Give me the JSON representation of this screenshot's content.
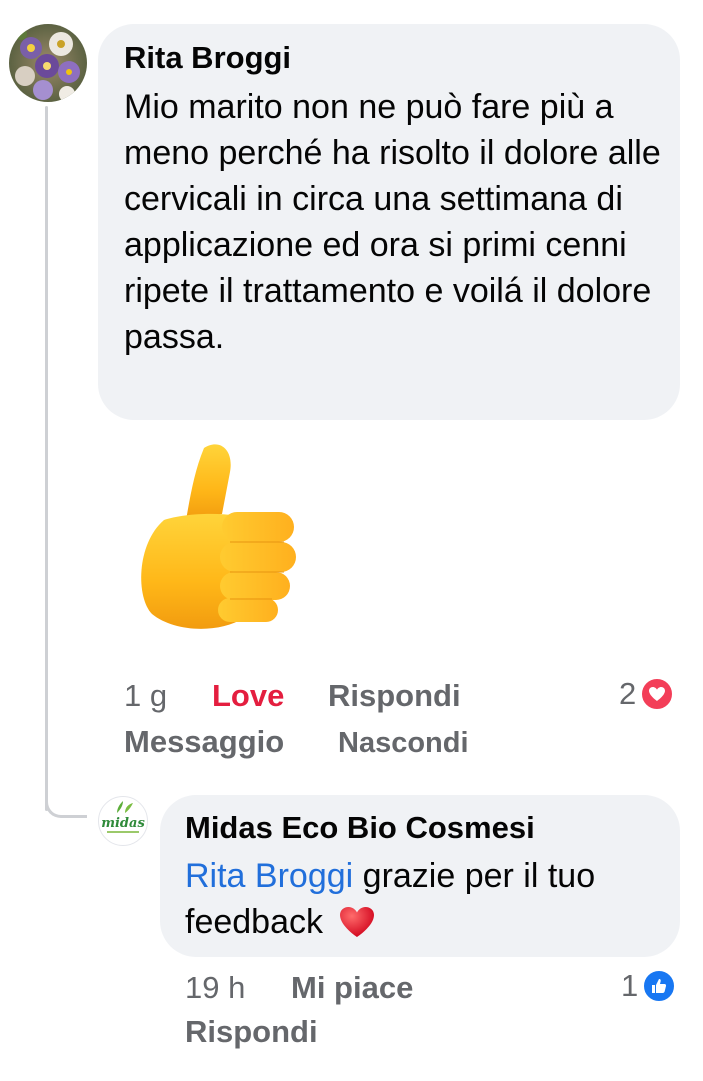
{
  "comment": {
    "author": "Rita Broggi",
    "text": "Mio marito non ne può fare più a meno perché ha risolto il dolore alle cervicali in circa una settimana di applicazione ed ora si primi cenni ripete il trattamento e voilá il dolore passa.",
    "sticker": "thumbs-up-sticker",
    "time": "1 g",
    "reaction_label": "Love",
    "reply_label": "Rispondi",
    "message_label": "Messaggio",
    "hide_label": "Nascondi",
    "reaction_count": "2",
    "reaction_icon": "love-heart-icon",
    "reaction_color": "#f33e58"
  },
  "reply": {
    "author": "Midas Eco Bio Cosmesi",
    "avatar_logo_text": "midas",
    "mention": "Rita Broggi",
    "text": "grazie per il tuo feedback",
    "emoji": "red-heart-icon",
    "time": "19 h",
    "like_label": "Mi piace",
    "reply_label": "Rispondi",
    "reaction_count": "1",
    "reaction_icon": "like-thumb-icon",
    "reaction_color": "#1877f2"
  },
  "colors": {
    "bubble": "#f0f2f5",
    "secondary_text": "#65676b",
    "mention": "#216fdb",
    "love": "#e41e3f"
  }
}
